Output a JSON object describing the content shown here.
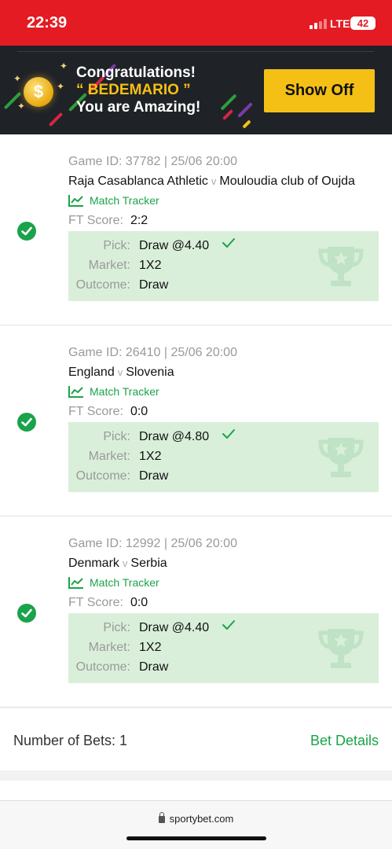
{
  "status": {
    "time": "22:39",
    "network": "LTE",
    "battery": "42"
  },
  "banner": {
    "line1": "Congratulations!",
    "line2": "“ BEDEMARIO ”",
    "line3": "You are Amazing!",
    "coin_symbol": "$",
    "button": "Show Off"
  },
  "labels": {
    "match_tracker": "Match Tracker",
    "ft_score": "FT Score:",
    "pick": "Pick:",
    "market": "Market:",
    "outcome": "Outcome:",
    "vs": "v"
  },
  "bets": [
    {
      "game_id": "Game ID: 37782 | 25/06 20:00",
      "home": "Raja Casablanca Athletic",
      "away": "Mouloudia club of Oujda",
      "ft_score": "2:2",
      "pick": "Draw @4.40",
      "market": "1X2",
      "outcome": "Draw"
    },
    {
      "game_id": "Game ID: 26410 | 25/06 20:00",
      "home": "England",
      "away": "Slovenia",
      "ft_score": "0:0",
      "pick": "Draw @4.80",
      "market": "1X2",
      "outcome": "Draw"
    },
    {
      "game_id": "Game ID: 12992 | 25/06 20:00",
      "home": "Denmark",
      "away": "Serbia",
      "ft_score": "0:0",
      "pick": "Draw @4.40",
      "market": "1X2",
      "outcome": "Draw"
    }
  ],
  "footer": {
    "number_of_bets": "Number of Bets: 1",
    "bet_details": "Bet Details"
  },
  "browser": {
    "url": "sportybet.com"
  },
  "icons": {
    "won": "check-circle-icon",
    "tracker": "line-chart-icon",
    "pick_ok": "checkmark-icon",
    "trophy": "trophy-watermark-icon"
  },
  "colors": {
    "brand_red": "#e41b23",
    "accent_yellow": "#f5c015",
    "win_green": "#1aa34a",
    "pick_bg": "#d9efda"
  }
}
